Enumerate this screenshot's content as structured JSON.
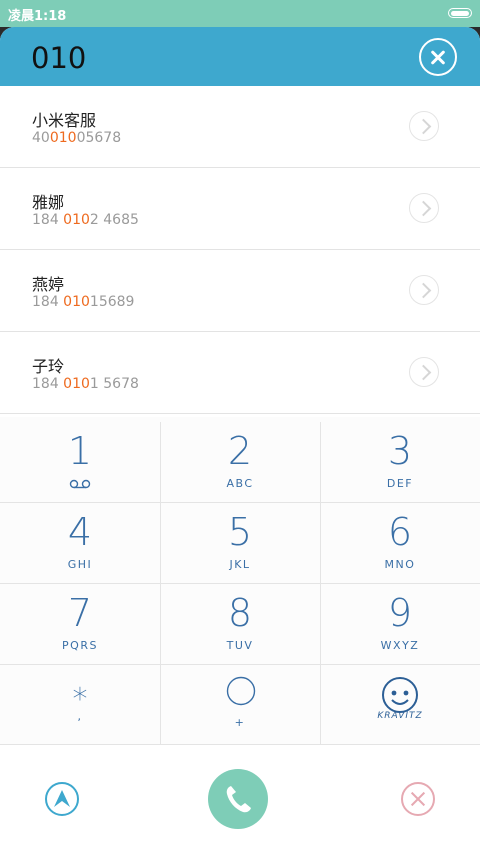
{
  "status_bar": {
    "time": "凌晨1:18",
    "battery_icon": "battery-icon"
  },
  "header": {
    "query": "010",
    "clear_icon": "close-icon"
  },
  "contacts": [
    {
      "name": "小米客服",
      "number_pre": "40",
      "number_match": "010",
      "number_post": "05678"
    },
    {
      "name": "雅娜",
      "number_pre": "184 ",
      "number_match": "010",
      "number_post": "2 4685"
    },
    {
      "name": "燕婷",
      "number_pre": "184 ",
      "number_match": "010",
      "number_post": "15689"
    },
    {
      "name": "子玲",
      "number_pre": "184 ",
      "number_match": "010",
      "number_post": "1 5678"
    }
  ],
  "keypad": [
    {
      "digit": "1",
      "letters": "",
      "icon": "voicemail-icon"
    },
    {
      "digit": "2",
      "letters": "ABC"
    },
    {
      "digit": "3",
      "letters": "DEF"
    },
    {
      "digit": "4",
      "letters": "GHI"
    },
    {
      "digit": "5",
      "letters": "JKL"
    },
    {
      "digit": "6",
      "letters": "MNO"
    },
    {
      "digit": "7",
      "letters": "PQRS"
    },
    {
      "digit": "8",
      "letters": "TUV"
    },
    {
      "digit": "9",
      "letters": "WXYZ"
    },
    {
      "digit": "*",
      "letters": ","
    },
    {
      "digit": "0",
      "letters": "+"
    },
    {
      "digit": "",
      "letters": "",
      "icon": "kravitz-logo",
      "logo_text": "KRAVITZ"
    }
  ],
  "bottom_bar": {
    "collapse_icon": "arrow-up-icon",
    "call_icon": "phone-icon",
    "delete_icon": "close-icon"
  },
  "colors": {
    "accent": "#3ea8ce",
    "green": "#7ecdb7",
    "highlight": "#ee6a1f",
    "key_text": "#3a6fa6"
  }
}
